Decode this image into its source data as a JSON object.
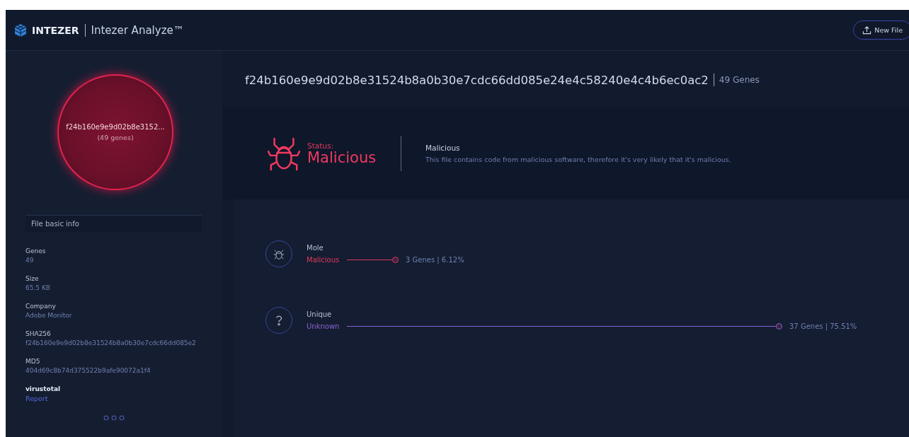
{
  "header": {
    "brand": "INTEZER",
    "product": "Intezer Analyze™",
    "new_file_button": "New File"
  },
  "sidebar": {
    "circle": {
      "hash": "f24b160e9e9d02b8e3152...",
      "genes": "(49 genes)"
    },
    "section_title": "File basic info",
    "fields": [
      {
        "label": "Genes",
        "value": "49",
        "kind": "text"
      },
      {
        "label": "Size",
        "value": "65.5 KB",
        "kind": "text"
      },
      {
        "label": "Company",
        "value": "Adobe Monitor",
        "kind": "text"
      },
      {
        "label": "SHA256",
        "value": "f24b160e9e9d02b8e31524b8a0b30e7cdc66dd085e2",
        "kind": "text"
      },
      {
        "label": "MD5",
        "value": "404d69c8b74d375522b9afe90072a1f4",
        "kind": "text"
      },
      {
        "label": "virustotal",
        "value": "Report",
        "kind": "link"
      }
    ]
  },
  "main": {
    "hash": "f24b160e9e9d02b8e31524b8a0b30e7cdc66dd085e24e4c58240e4c4b6ec0ac2",
    "genes": "49 Genes",
    "status": {
      "label": "Status:",
      "value": "Malicious",
      "title": "Malicious",
      "description": "This file contains code from malicious software, therefore it's very likely that it's malicious."
    },
    "families": [
      {
        "name": "Mole",
        "kind": "malicious",
        "type_label": "Malicious",
        "reading": "3 Genes | 6.12%"
      },
      {
        "name": "Unique",
        "kind": "unknown",
        "type_label": "Unknown",
        "reading": "37 Genes | 75.51%"
      }
    ]
  }
}
